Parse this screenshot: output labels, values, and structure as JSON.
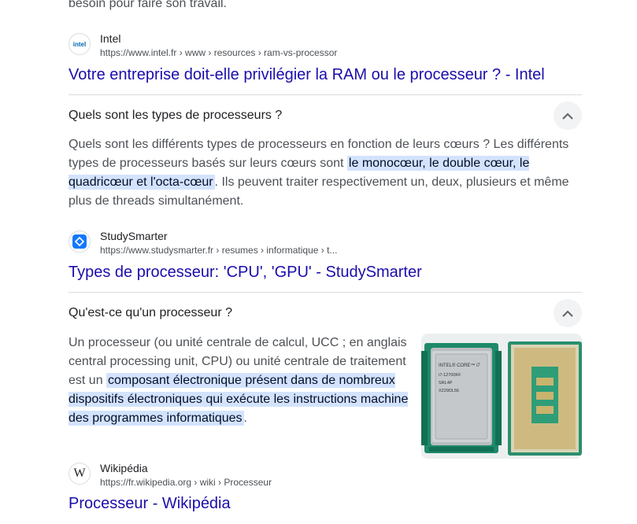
{
  "top_text": "besoin pour faire son travail.",
  "result_intel": {
    "favicon_text": "intel",
    "name": "Intel",
    "url": "https://www.intel.fr › www › resources › ram-vs-processor",
    "title": "Votre entreprise doit-elle privilégier la RAM ou le processeur ? - Intel"
  },
  "question1": {
    "text": "Quels sont les types de processeurs ?",
    "answer_before": "Quels sont les différents types de processeurs en fonction de leurs cœurs ? Les différents types de processeurs basés sur leurs cœurs sont ",
    "answer_highlight": "le monocœur, le double cœur, le quadricœur et l'octa-cœur",
    "answer_after": ". Ils peuvent traiter respectivement un, deux, plusieurs et même plus de threads simultanément."
  },
  "result_studysmarter": {
    "name": "StudySmarter",
    "url": "https://www.studysmarter.fr › resumes › informatique › t...",
    "title": "Types de processeur: 'CPU', 'GPU' - StudySmarter"
  },
  "question2": {
    "text": "Qu'est-ce qu'un processeur ?",
    "answer_before": "Un processeur (ou unité centrale de calcul, UCC ; en anglais central processing unit, CPU) ou unité centrale de traitement est un ",
    "answer_highlight": "composant électronique présent dans de nombreux dispositifs électroniques qui exécute les instructions machine des programmes informatiques",
    "answer_after": ".",
    "image_chip_text": [
      "INTEL® CORE™ i7",
      "i7-12700KF",
      "SRL4P",
      "X229DL56"
    ]
  },
  "result_wikipedia": {
    "favicon_text": "W",
    "name": "Wikipédia",
    "url": "https://fr.wikipedia.org › wiki › Processeur",
    "title": "Processeur - Wikipédia"
  },
  "colors": {
    "link": "#1a0dab",
    "highlight": "#d3e3fd",
    "intel_blue": "#0068b5",
    "studysmarter_blue": "#1478ff"
  }
}
